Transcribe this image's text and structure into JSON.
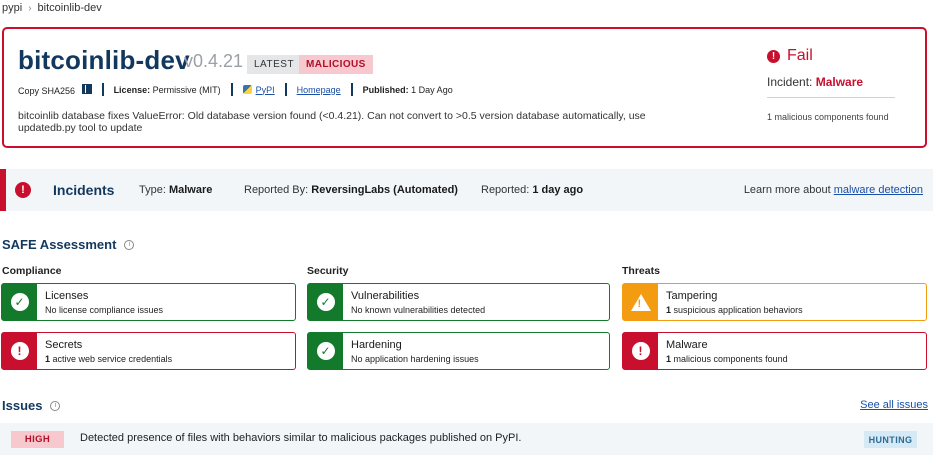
{
  "breadcrumb": {
    "root": "pypi",
    "separator": "›",
    "current": "bitcoinlib-dev"
  },
  "package": {
    "name": "bitcoinlib-dev",
    "version": "v0.4.21",
    "badges": {
      "latest": "LATEST",
      "malicious": "MALICIOUS"
    },
    "meta": {
      "copy_label": "Copy SHA256",
      "license_key": "License:",
      "license_value": "Permissive (MIT)",
      "pypi_link": "PyPI",
      "homepage_link": "Homepage",
      "published_key": "Published:",
      "published_value": "1 Day Ago"
    },
    "description": "bitcoinlib database fixes ValueError: Old database version found (<0.4.21). Can not convert to >0.5 version database automatically, use updatedb.py tool to update"
  },
  "status": {
    "label": "Fail",
    "incident_key": "Incident:",
    "incident_value": "Malware",
    "note": "1 malicious components found"
  },
  "incidents": {
    "title": "Incidents",
    "type_key": "Type:",
    "type_value": "Malware",
    "reported_by_key": "Reported By:",
    "reported_by_value": "ReversingLabs (Automated)",
    "reported_key": "Reported:",
    "reported_value": "1 day ago",
    "learn_prefix": "Learn more about",
    "learn_link": "malware detection"
  },
  "safe": {
    "title": "SAFE Assessment",
    "columns": {
      "compliance": "Compliance",
      "security": "Security",
      "threats": "Threats"
    },
    "tiles": {
      "licenses": {
        "title": "Licenses",
        "desc": "No license compliance issues"
      },
      "secrets": {
        "title": "Secrets",
        "count": "1",
        "desc": "active web service credentials"
      },
      "vulnerabilities": {
        "title": "Vulnerabilities",
        "desc": "No known vulnerabilities detected"
      },
      "hardening": {
        "title": "Hardening",
        "desc": "No application hardening issues"
      },
      "tampering": {
        "title": "Tampering",
        "count": "1",
        "desc": "suspicious application behaviors"
      },
      "malware": {
        "title": "Malware",
        "count": "1",
        "desc": "malicious components found"
      }
    }
  },
  "issues": {
    "title": "Issues",
    "see_all": "See all issues",
    "rows": [
      {
        "severity": "HIGH",
        "text": "Detected presence of files with behaviors similar to malicious packages published on PyPI.",
        "tag": "HUNTING"
      }
    ]
  },
  "colors": {
    "fail_red": "#c8102e",
    "pass_green": "#137a2b",
    "warn_orange": "#f39c12",
    "brand_navy": "#13385e"
  }
}
